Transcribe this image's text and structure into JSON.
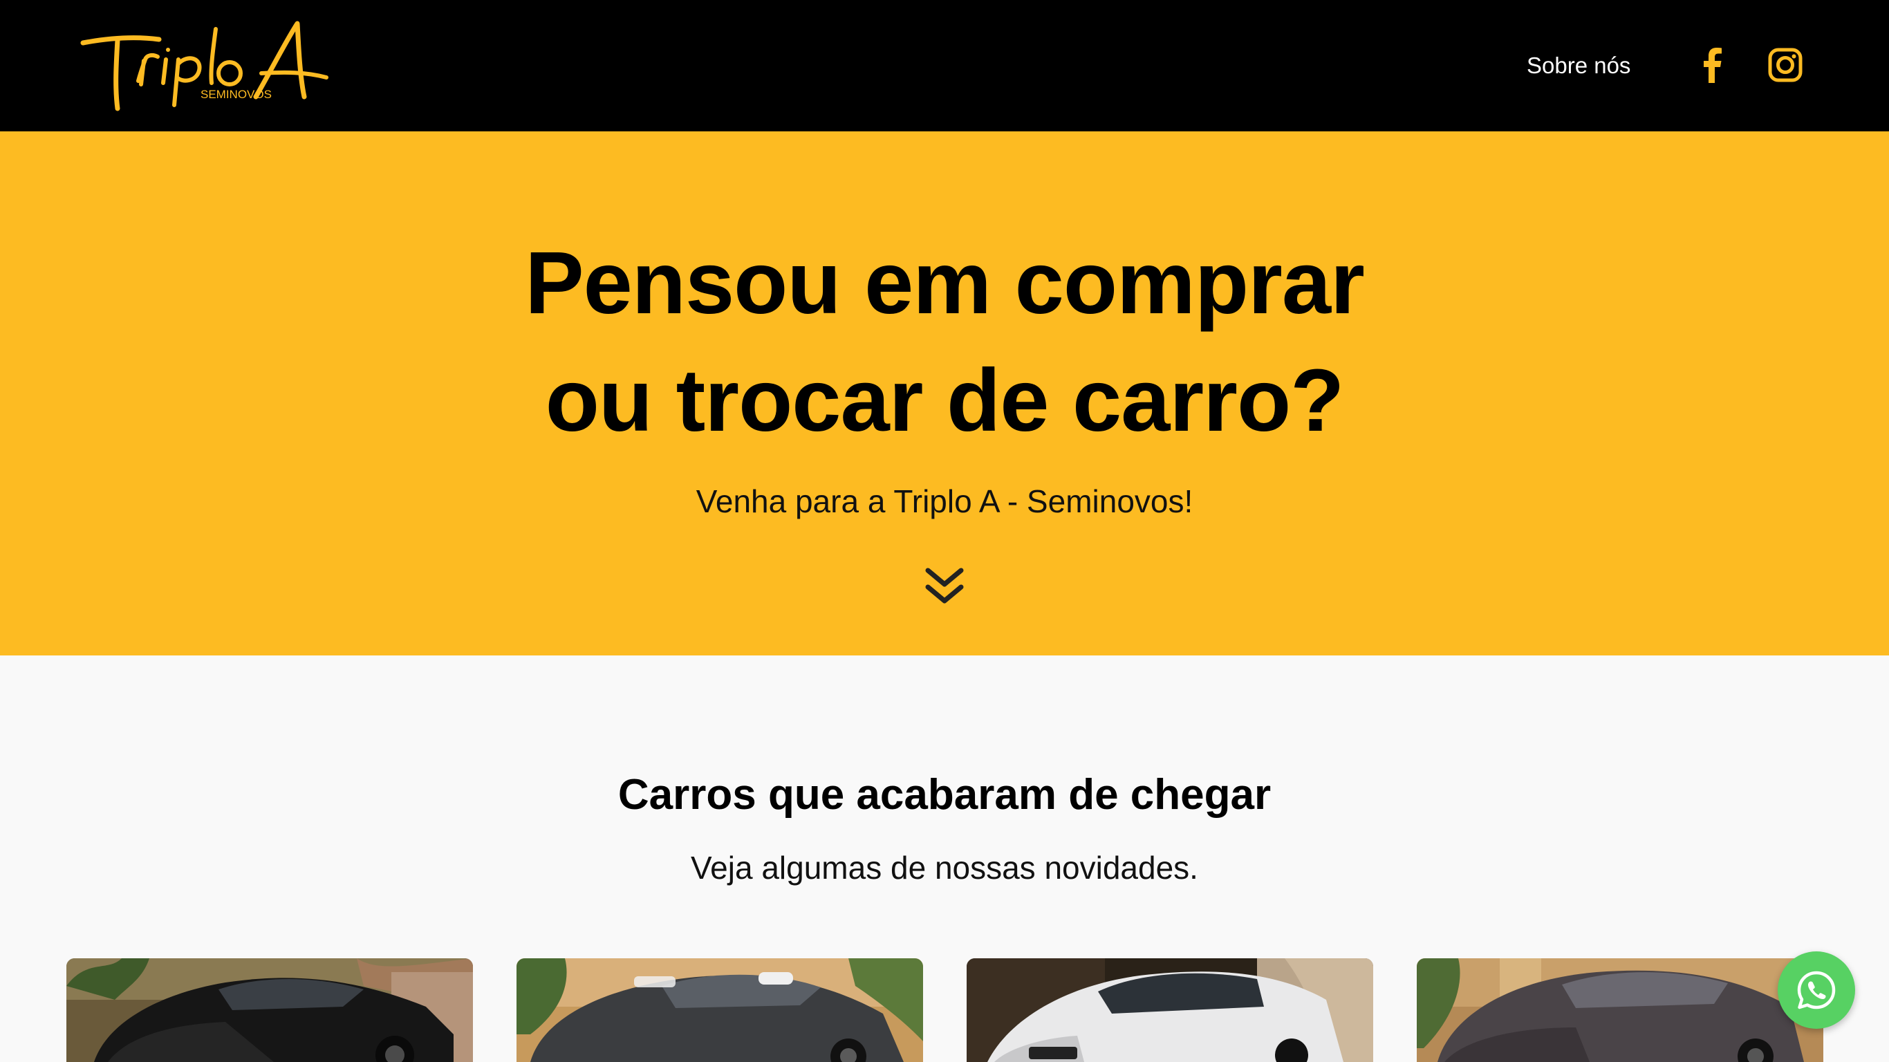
{
  "colors": {
    "brand_yellow": "#fdbb22",
    "header_bg": "#000000",
    "page_bg": "#f9f9f9",
    "whatsapp_green": "#57d163"
  },
  "header": {
    "logo": {
      "wordmark": "Triplo A",
      "tagline": "SEMINOVOS",
      "icon": "triplo-a-logo"
    },
    "nav": {
      "about_label": "Sobre nós"
    },
    "social": [
      {
        "icon": "facebook-icon"
      },
      {
        "icon": "instagram-icon"
      }
    ]
  },
  "hero": {
    "title_line1": "Pensou em comprar",
    "title_line2": "ou trocar de carro?",
    "subtitle": "Venha para a Triplo A - Seminovos!",
    "scroll_icon": "double-chevron-down-icon"
  },
  "arrivals": {
    "title": "Carros que acabaram de chegar",
    "subtitle": "Veja algumas de nossas novidades.",
    "cards": [
      {
        "car_color": "black",
        "type": "sedan"
      },
      {
        "car_color": "dark gray",
        "type": "sedan"
      },
      {
        "car_color": "white",
        "type": "hatchback"
      },
      {
        "car_color": "dark gray",
        "type": "hatchback"
      }
    ]
  },
  "whatsapp": {
    "icon": "whatsapp-icon"
  }
}
